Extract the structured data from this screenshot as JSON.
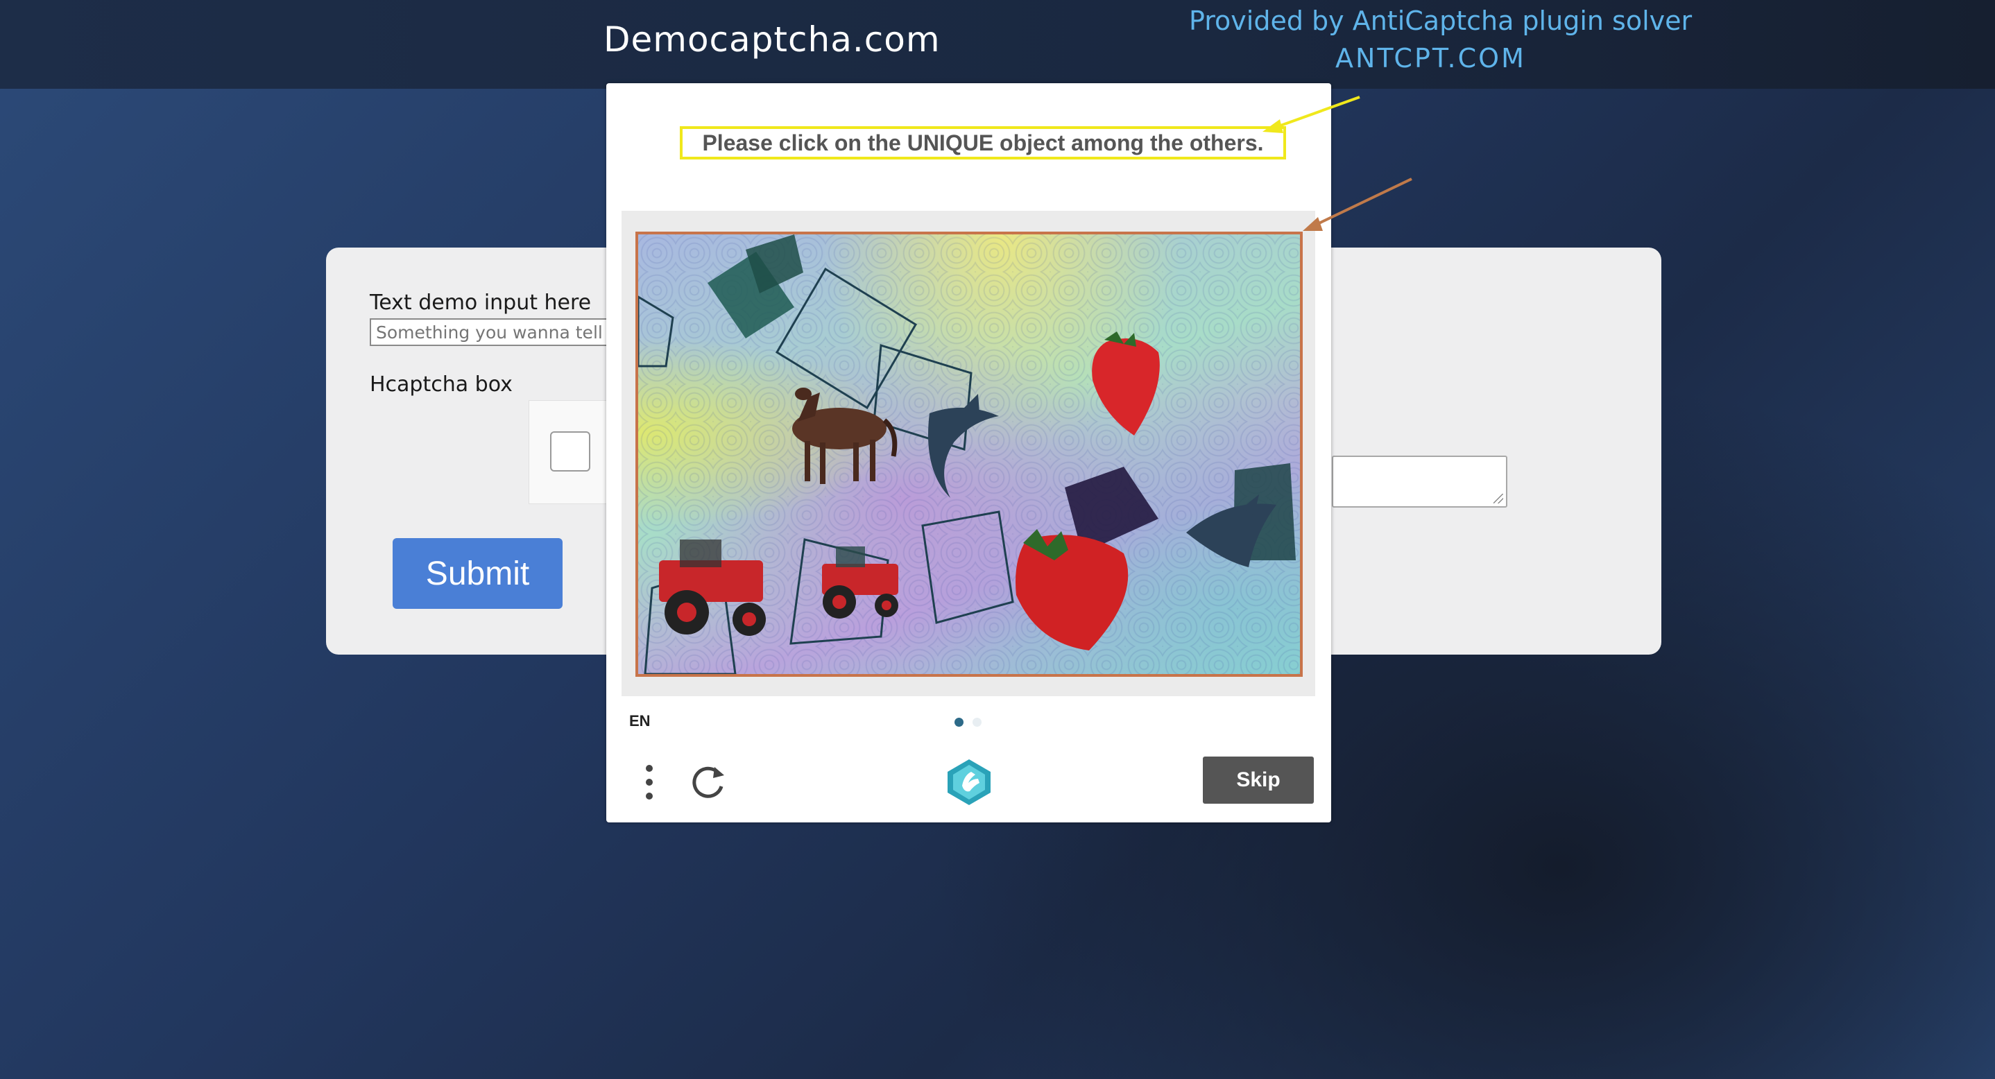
{
  "header": {
    "site_title": "Democaptcha.com",
    "provided_by": "Provided by AntiCaptcha plugin solver",
    "antcpt": "ANTCPT.COM"
  },
  "form": {
    "text_label": "Text demo input here",
    "text_placeholder": "Something you wanna tell th",
    "hcaptcha_label": "Hcaptcha box",
    "submit_label": "Submit"
  },
  "challenge": {
    "prompt": "Please click on the UNIQUE object among the others.",
    "language": "EN",
    "skip_label": "Skip",
    "page_indicator": {
      "current": 1,
      "total": 2
    },
    "icons": [
      "menu-icon",
      "refresh-icon",
      "hcaptcha-logo-icon"
    ],
    "objects": [
      "horse",
      "dolphin",
      "dolphin",
      "strawberry",
      "strawberry",
      "tractor",
      "tractor"
    ]
  },
  "colors": {
    "submit": "#4a7fd6",
    "skip": "#555555",
    "prompt_highlight": "#f0e81c",
    "image_border": "#c8744a",
    "annotation_text": "#5fb4ea"
  }
}
